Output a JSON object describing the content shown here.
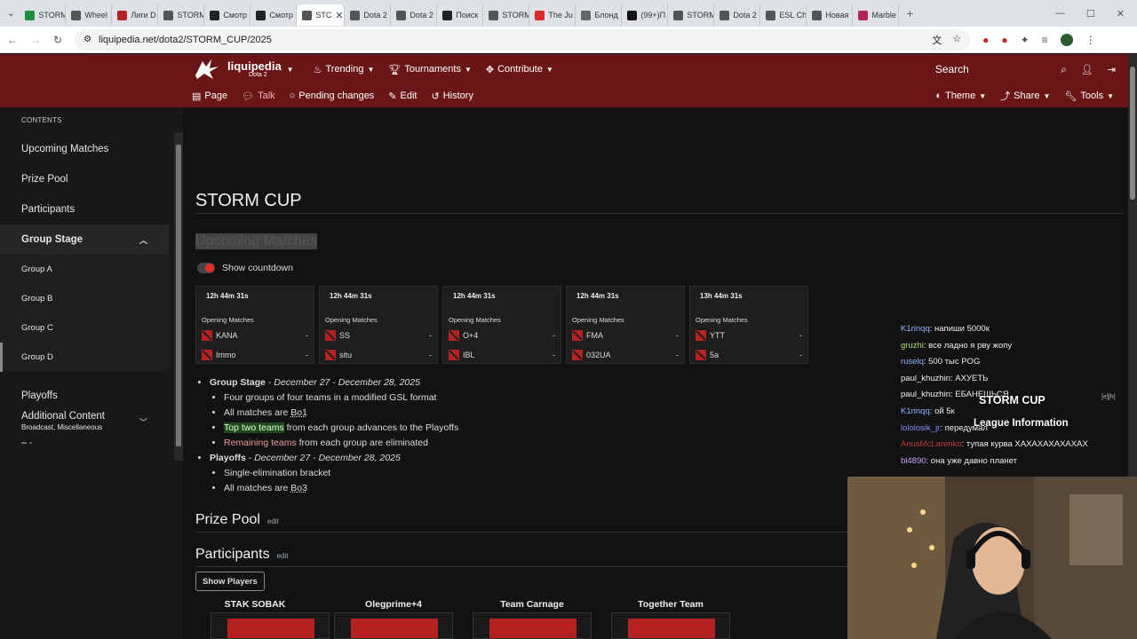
{
  "browser": {
    "tabs": [
      {
        "label": "STORM",
        "color": "#1e8e3e"
      },
      {
        "label": "Wheel",
        "color": "#555555"
      },
      {
        "label": "Лиги D",
        "color": "#b52222"
      },
      {
        "label": "STORM",
        "color": "#555555"
      },
      {
        "label": "Смотр",
        "color": "#222222"
      },
      {
        "label": "Смотр",
        "color": "#222222"
      },
      {
        "label": "STC",
        "color": "#555555",
        "active": true
      },
      {
        "label": "Dota 2",
        "color": "#555555"
      },
      {
        "label": "Dota 2",
        "color": "#555555"
      },
      {
        "label": "Поиск",
        "color": "#222222"
      },
      {
        "label": "STORM",
        "color": "#555555"
      },
      {
        "label": "The Ju",
        "color": "#d92b2b"
      },
      {
        "label": "Блонд",
        "color": "#666666"
      },
      {
        "label": "(99+)П",
        "color": "#111111"
      },
      {
        "label": "STORM",
        "color": "#555555"
      },
      {
        "label": "Dota 2",
        "color": "#555555"
      },
      {
        "label": "ESL Ch",
        "color": "#555555"
      },
      {
        "label": "Новая",
        "color": "#555555"
      },
      {
        "label": "Marble",
        "color": "#b5225c"
      }
    ],
    "tab_prefix": {
      "hd": "HD"
    },
    "url": "liquipedia.net/dota2/STORM_CUP/2025"
  },
  "nav": {
    "brand": "liquipedia",
    "brand_sub": "Dota 2",
    "trending": "Trending",
    "tournaments": "Tournaments",
    "contribute": "Contribute",
    "search": "Search",
    "page": "Page",
    "talk": "Talk",
    "pending": "Pending changes",
    "edit": "Edit",
    "history": "History",
    "theme": "Theme",
    "share": "Share",
    "tools": "Tools"
  },
  "sidebar": {
    "heading": "CONTENTS",
    "items": [
      "Upcoming Matches",
      "Prize Pool",
      "Participants"
    ],
    "group": "Group Stage",
    "subitems": [
      "Group A",
      "Group B",
      "Group C",
      "Group D"
    ],
    "playoffs": "Playoffs",
    "additional": "Additional Content",
    "additional_sub": "Broadcast, Miscellaneous",
    "cutoff": "R f"
  },
  "main": {
    "title": "STORM CUP",
    "upcoming": "Upcoming Matches",
    "countdown_label": "Show countdown",
    "matches": [
      {
        "time": "12h 44m 31s",
        "stage": "Opening Matches",
        "team1": "KANA",
        "team2": "Immo",
        "s1": "-",
        "s2": "-"
      },
      {
        "time": "12h 44m 31s",
        "stage": "Opening Matches",
        "team1": "SS",
        "team2": "situ",
        "s1": "-",
        "s2": "-"
      },
      {
        "time": "12h 44m 31s",
        "stage": "Opening Matches",
        "team1": "O+4",
        "team2": "IBL",
        "s1": "-",
        "s2": "-"
      },
      {
        "time": "12h 44m 31s",
        "stage": "Opening Matches",
        "team1": "FMA",
        "team2": "032UA",
        "s1": "-",
        "s2": "-"
      },
      {
        "time": "13h 44m 31s",
        "stage": "Opening Matches",
        "team1": "YTT",
        "team2": "5a",
        "s1": "-",
        "s2": "-"
      }
    ],
    "format": {
      "group_label": "Group Stage",
      "group_dates": "December 27 - December 28, 2025",
      "g1": "Four groups of four teams in a modified GSL format",
      "g2a": "All matches are ",
      "g2b": "Bo1",
      "g3a": "Top two teams",
      "g3b": " from each group advances to the Playoffs",
      "g4a": "Remaining teams",
      "g4b": " from each group are eliminated",
      "playoffs_label": "Playoffs",
      "playoffs_dates": "December 27 - December 28, 2025",
      "p1": "Single-elimination bracket",
      "p2a": "All matches are ",
      "p2b": "Bo3",
      "sep": " - "
    },
    "prize_pool": "Prize Pool",
    "participants": "Participants",
    "edit": "edit",
    "show_players": "Show Players",
    "teams": [
      "STAK SOBAK",
      "Olegprime+4",
      "Team Carnage",
      "Together Team"
    ]
  },
  "overlay": {
    "chat": [
      {
        "user": "K1rinqq",
        "color": "#8ab4ff",
        "msg": ": напиши 5000к"
      },
      {
        "user": "gruzhi",
        "color": "#a7e36a",
        "msg": ": все ладно я рву жопу"
      },
      {
        "user": "ruselq",
        "color": "#8ab4ff",
        "msg": ": 500 тыс POG"
      },
      {
        "user": "paul_khuzhin",
        "color": "#f0f0f0",
        "msg": ": АХУЕТЬ"
      },
      {
        "user": "paul_khuzhin",
        "color": "#f0f0f0",
        "msg": ": ЕБАНЕШЬСЯ"
      },
      {
        "user": "K1rinqq",
        "color": "#8ab4ff",
        "msg": ": ой 5к"
      },
      {
        "user": "lololosik_jr",
        "color": "#8a8aff",
        "msg": ": передумал"
      },
      {
        "user": "AnusMcLarenko",
        "color": "#c23a3a",
        "msg": ": тупая курва ХАХАХАХАХАХАХ"
      },
      {
        "user": "bl4890",
        "color": "#c8a8ff",
        "msg": ": она уже давно планет"
      }
    ],
    "title": "STORM CUP",
    "subtitle": "League Information",
    "icons": "[e][h]"
  }
}
